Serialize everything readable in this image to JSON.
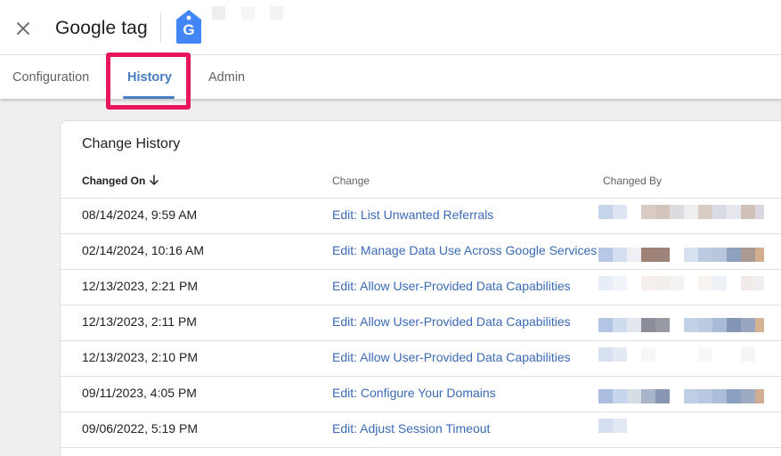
{
  "header": {
    "title": "Google tag",
    "logo_letter": "G"
  },
  "tabs": [
    {
      "label": "Configuration",
      "active": false
    },
    {
      "label": "History",
      "active": true
    },
    {
      "label": "Admin",
      "active": false
    }
  ],
  "card": {
    "title": "Change History",
    "columns": {
      "changed_on": "Changed On",
      "change": "Change",
      "changed_by": "Changed By"
    },
    "rows": [
      {
        "changed_on": "08/14/2024, 9:59 AM",
        "change": "Edit: List Unwanted Referrals"
      },
      {
        "changed_on": "02/14/2024, 10:16 AM",
        "change": "Edit: Manage Data Use Across Google Services"
      },
      {
        "changed_on": "12/13/2023, 2:21 PM",
        "change": "Edit: Allow User-Provided Data Capabilities"
      },
      {
        "changed_on": "12/13/2023, 2:11 PM",
        "change": "Edit: Allow User-Provided Data Capabilities"
      },
      {
        "changed_on": "12/13/2023, 2:10 PM",
        "change": "Edit: Allow User-Provided Data Capabilities"
      },
      {
        "changed_on": "09/11/2023, 4:05 PM",
        "change": "Edit: Configure Your Domains"
      },
      {
        "changed_on": "09/06/2022, 5:19 PM",
        "change": "Edit: Adjust Session Timeout"
      }
    ]
  },
  "colors": {
    "accent": "#4a7cc0",
    "link": "#3b6ab5",
    "highlight": "#e8155e",
    "tag_logo": "#4285f4"
  }
}
